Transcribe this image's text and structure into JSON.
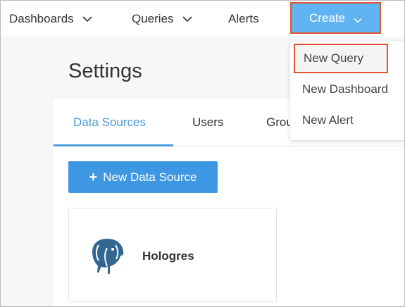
{
  "nav": {
    "items": [
      {
        "label": "Dashboards"
      },
      {
        "label": "Queries"
      },
      {
        "label": "Alerts"
      }
    ],
    "create_label": "Create"
  },
  "create_menu": {
    "items": [
      {
        "label": "New Query"
      },
      {
        "label": "New Dashboard"
      },
      {
        "label": "New Alert"
      }
    ]
  },
  "page": {
    "title": "Settings"
  },
  "tabs": [
    {
      "label": "Data Sources",
      "active": true
    },
    {
      "label": "Users"
    },
    {
      "label": "Groups"
    }
  ],
  "new_data_source_label": "New Data Source",
  "data_sources": [
    {
      "name": "Hologres",
      "icon": "postgresql-elephant-icon"
    }
  ],
  "colors": {
    "accent": "#3d97e3",
    "create_button": "#61b4f2",
    "highlight_border": "#e2532f"
  }
}
